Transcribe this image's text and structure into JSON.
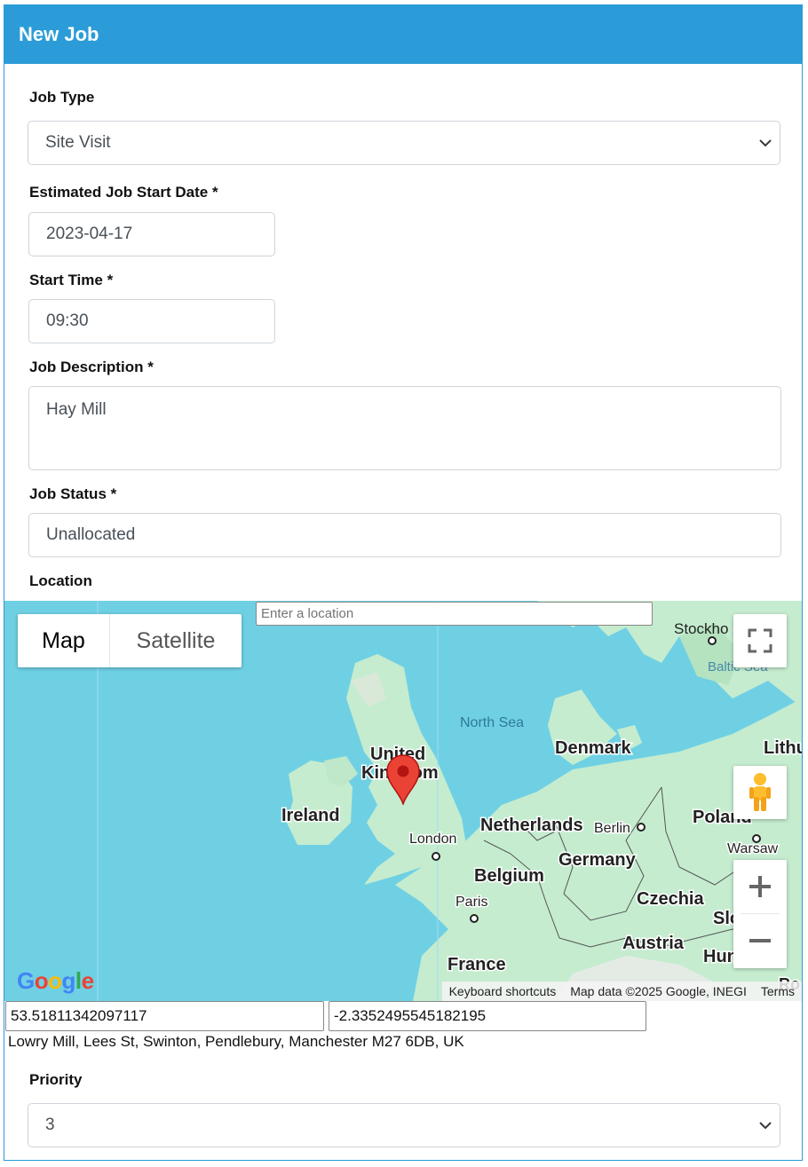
{
  "header": {
    "title": "New Job"
  },
  "form": {
    "job_type": {
      "label": "Job Type",
      "value": "Site Visit"
    },
    "start_date": {
      "label": "Estimated Job Start Date",
      "required_mark": "*",
      "value": "2023-04-17"
    },
    "start_time": {
      "label": "Start Time",
      "required_mark": "*",
      "value": "09:30"
    },
    "description": {
      "label": "Job Description",
      "required_mark": "*",
      "value": "Hay Mill"
    },
    "status": {
      "label": "Job Status",
      "required_mark": "*",
      "value": "Unallocated"
    },
    "location": {
      "label": "Location"
    },
    "priority": {
      "label": "Priority",
      "value": "3"
    }
  },
  "map": {
    "type_buttons": {
      "map": "Map",
      "satellite": "Satellite"
    },
    "search_placeholder": "Enter a location",
    "labels": {
      "stockholm": "Stockho",
      "baltic_sea": "Baltic Sea",
      "north_sea": "North Sea",
      "denmark": "Denmark",
      "lithuania": "Lithu",
      "united_kingdom_1": "United",
      "united_kingdom_2": "Kingdom",
      "ireland": "Ireland",
      "netherlands": "Netherlands",
      "berlin": "Berlin",
      "poland": "Poland",
      "london": "London",
      "warsaw": "Warsaw",
      "germany": "Germany",
      "belgium": "Belgium",
      "czechia": "Czechia",
      "paris": "Paris",
      "slovakia": "Slo",
      "austria": "Austria",
      "hungary": "Hun",
      "france": "France",
      "romania": "Ro"
    },
    "attribution": {
      "shortcuts": "Keyboard shortcuts",
      "data": "Map data ©2025 Google, INEGI",
      "terms": "Terms"
    },
    "colors": {
      "water": "#6fd0e4",
      "land": "#c5eccf",
      "marker": "#ea4335"
    }
  },
  "coords": {
    "lat": "53.51811342097117",
    "lng": "-2.3352495545182195"
  },
  "address": "Lowry Mill, Lees St, Swinton, Pendlebury, Manchester M27 6DB, UK"
}
